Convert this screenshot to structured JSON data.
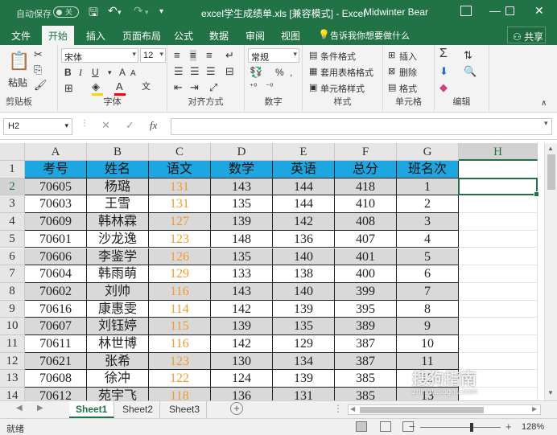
{
  "titlebar": {
    "autosave_label": "自动保存",
    "autosave_state": "关",
    "title": "excel学生成绩单.xls  [兼容模式]  -  Excel",
    "user": "Midwinter Bear",
    "icons": [
      "save-icon",
      "undo-icon",
      "redo-icon",
      "customize-qat-icon",
      "ribbon-display-icon",
      "minimize-icon",
      "restore-icon",
      "close-icon"
    ]
  },
  "tabs": {
    "items": [
      "文件",
      "开始",
      "插入",
      "页面布局",
      "公式",
      "数据",
      "审阅",
      "视图"
    ],
    "active": "开始",
    "tell_me": "告诉我你想要做什么",
    "share": "共享"
  },
  "ribbon": {
    "clipboard": {
      "label": "剪贴板",
      "paste": "粘贴"
    },
    "font": {
      "label": "字体",
      "font_name": "宋体",
      "font_size": "12",
      "bold": "B",
      "italic": "I",
      "underline": "U",
      "font_color": "#ff0000",
      "fill_color": "#ffd400"
    },
    "alignment": {
      "label": "对齐方式"
    },
    "number": {
      "label": "数字",
      "format": "常规",
      "percent": "%",
      "comma": ","
    },
    "styles": {
      "label": "样式",
      "items": [
        "条件格式",
        "套用表格格式",
        "单元格样式"
      ]
    },
    "cells": {
      "label": "单元格",
      "items": [
        "插入",
        "删除",
        "格式"
      ]
    },
    "editing": {
      "label": "编辑"
    }
  },
  "formula_bar": {
    "name_box": "H2",
    "cancel": "✕",
    "enter": "✓",
    "fx": "fx",
    "formula": ""
  },
  "grid": {
    "columns": [
      "A",
      "B",
      "C",
      "D",
      "E",
      "F",
      "G",
      "H"
    ],
    "selected_column": "H",
    "selected_row": 2,
    "selected_cell": "H2",
    "row_numbers": [
      1,
      2,
      3,
      4,
      5,
      6,
      7,
      8,
      9,
      10,
      11,
      12,
      13,
      14
    ],
    "header": [
      "考号",
      "姓名",
      "语文",
      "数学",
      "英语",
      "总分",
      "班名次"
    ],
    "header_color": "#1ea6e0",
    "alt_row_color": "#d9d9d9",
    "chinese_score_color": "#f29a2e",
    "rows": [
      [
        "70605",
        "杨璐",
        "131",
        "143",
        "144",
        "418",
        "1"
      ],
      [
        "70603",
        "王雪",
        "131",
        "135",
        "144",
        "410",
        "2"
      ],
      [
        "70609",
        "韩林霖",
        "127",
        "139",
        "142",
        "408",
        "3"
      ],
      [
        "70601",
        "沙龙逸",
        "123",
        "148",
        "136",
        "407",
        "4"
      ],
      [
        "70606",
        "李鉴学",
        "126",
        "135",
        "140",
        "401",
        "5"
      ],
      [
        "70604",
        "韩雨萌",
        "129",
        "133",
        "138",
        "400",
        "6"
      ],
      [
        "70602",
        "刘帅",
        "116",
        "143",
        "140",
        "399",
        "7"
      ],
      [
        "70616",
        "康惠雯",
        "114",
        "142",
        "139",
        "395",
        "8"
      ],
      [
        "70607",
        "刘钰婷",
        "115",
        "139",
        "135",
        "389",
        "9"
      ],
      [
        "70611",
        "林世博",
        "116",
        "142",
        "129",
        "387",
        "10"
      ],
      [
        "70621",
        "张希",
        "123",
        "130",
        "134",
        "387",
        "11"
      ],
      [
        "70608",
        "徐冲",
        "122",
        "124",
        "139",
        "385",
        "12"
      ],
      [
        "70612",
        "苑宇飞",
        "118",
        "136",
        "131",
        "385",
        "13"
      ]
    ]
  },
  "sheets": {
    "tabs": [
      "Sheet1",
      "Sheet2",
      "Sheet3"
    ],
    "active": "Sheet1",
    "add_icon": "+"
  },
  "status": {
    "ready": "就绪",
    "zoom": "128%",
    "zoom_out": "−",
    "zoom_in": "+"
  },
  "watermark": {
    "text": "搜狗指南",
    "url": "zhinan.sogou.com"
  }
}
